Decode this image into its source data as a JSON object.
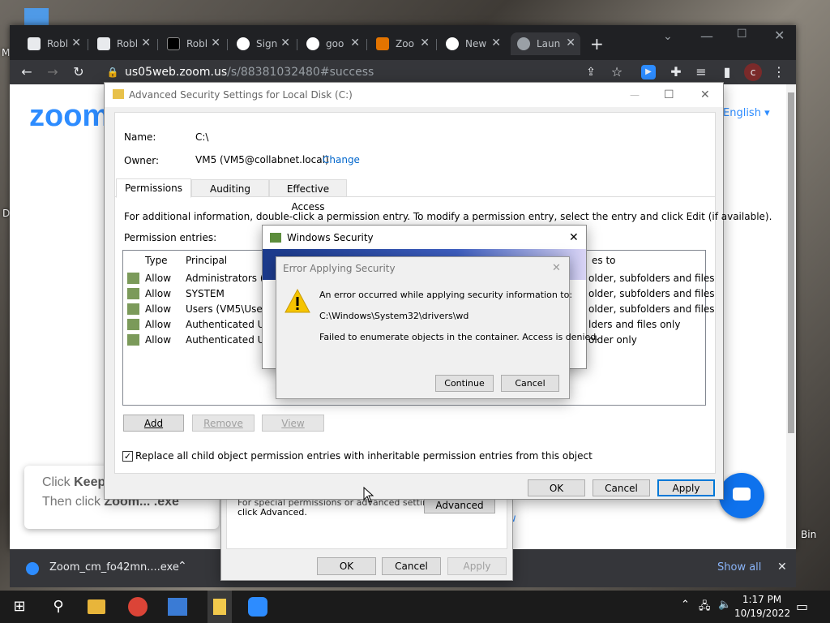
{
  "desktop": {
    "left_label": "M",
    "left_label2": "D",
    "recycle_label": "Bin"
  },
  "browser": {
    "tabs": [
      {
        "label": "Robl",
        "icon": "roblox-icon",
        "color": "#e8eaed"
      },
      {
        "label": "Robl",
        "icon": "roblox-icon",
        "color": "#e8eaed"
      },
      {
        "label": "Robl",
        "icon": "roblox-icon",
        "color": "#222222"
      },
      {
        "label": "Sign",
        "icon": "google-icon",
        "color": "#ffffff"
      },
      {
        "label": "goo",
        "icon": "google-icon",
        "color": "#ffffff"
      },
      {
        "label": "Zoo",
        "icon": "zoom-icon",
        "color": "#e37400"
      },
      {
        "label": "New",
        "icon": "chrome-icon",
        "color": "#ffffff"
      },
      {
        "label": "Laun",
        "icon": "globe-icon",
        "color": "#9aa0a6"
      }
    ],
    "new_tab": "+",
    "url_domain": "us05web.zoom.us",
    "url_path": "/s/88381032480#success",
    "profile_initial": "c",
    "page": {
      "logo": "zoom",
      "language": "English ▾",
      "banner_line1_a": "Click ",
      "banner_line1_b": "Keep",
      "banner_line2_a": "Then click ",
      "banner_line2_b": "Zoom... .exe",
      "side_link": "w"
    },
    "download": {
      "file": "Zoom_cm_fo42mn....exe",
      "show_all": "Show all",
      "close": "✕"
    }
  },
  "advanced_security": {
    "title": "Advanced Security Settings for Local Disk (C:)",
    "name_label": "Name:",
    "name_value": "C:\\",
    "owner_label": "Owner:",
    "owner_value": "VM5 (VM5@collabnet.local)",
    "change_link": "Change",
    "tabs": [
      "Permissions",
      "Auditing",
      "Effective Access"
    ],
    "info_text": "For additional information, double-click a permission entry. To modify a permission entry, select the entry and click Edit (if available).",
    "entries_label": "Permission entries:",
    "columns": [
      "Type",
      "Principal",
      "es to"
    ],
    "rows": [
      {
        "type": "Allow",
        "principal": "Administrators (VI",
        "applies": "older, subfolders and files"
      },
      {
        "type": "Allow",
        "principal": "SYSTEM",
        "applies": "older, subfolders and files"
      },
      {
        "type": "Allow",
        "principal": "Users (VM5\\Users)",
        "applies": "older, subfolders and files"
      },
      {
        "type": "Allow",
        "principal": "Authenticated Use",
        "applies": "lders and files only"
      },
      {
        "type": "Allow",
        "principal": "Authenticated Use",
        "applies": "older only"
      }
    ],
    "add": "Add",
    "remove": "Remove",
    "view": "View",
    "replace_text": "Replace all child object permission entries with inheritable permission entries from this object",
    "replace_checked": true,
    "ok": "OK",
    "cancel": "Cancel",
    "apply": "Apply"
  },
  "windows_security": {
    "title": "Windows Security"
  },
  "error_dialog": {
    "title": "Error Applying Security",
    "line1": "An error occurred while applying security information to:",
    "path": "C:\\Windows\\System32\\drivers\\wd",
    "line2": "Failed to enumerate objects in the container. Access is denied.",
    "continue": "Continue",
    "cancel": "Cancel"
  },
  "properties": {
    "text1": "For special permissions or advanced settings,",
    "text2": "click Advanced.",
    "advanced": "Advanced",
    "ok": "OK",
    "cancel": "Cancel",
    "apply": "Apply"
  },
  "taskbar": {
    "time": "1:17 PM",
    "date": "10/19/2022"
  }
}
